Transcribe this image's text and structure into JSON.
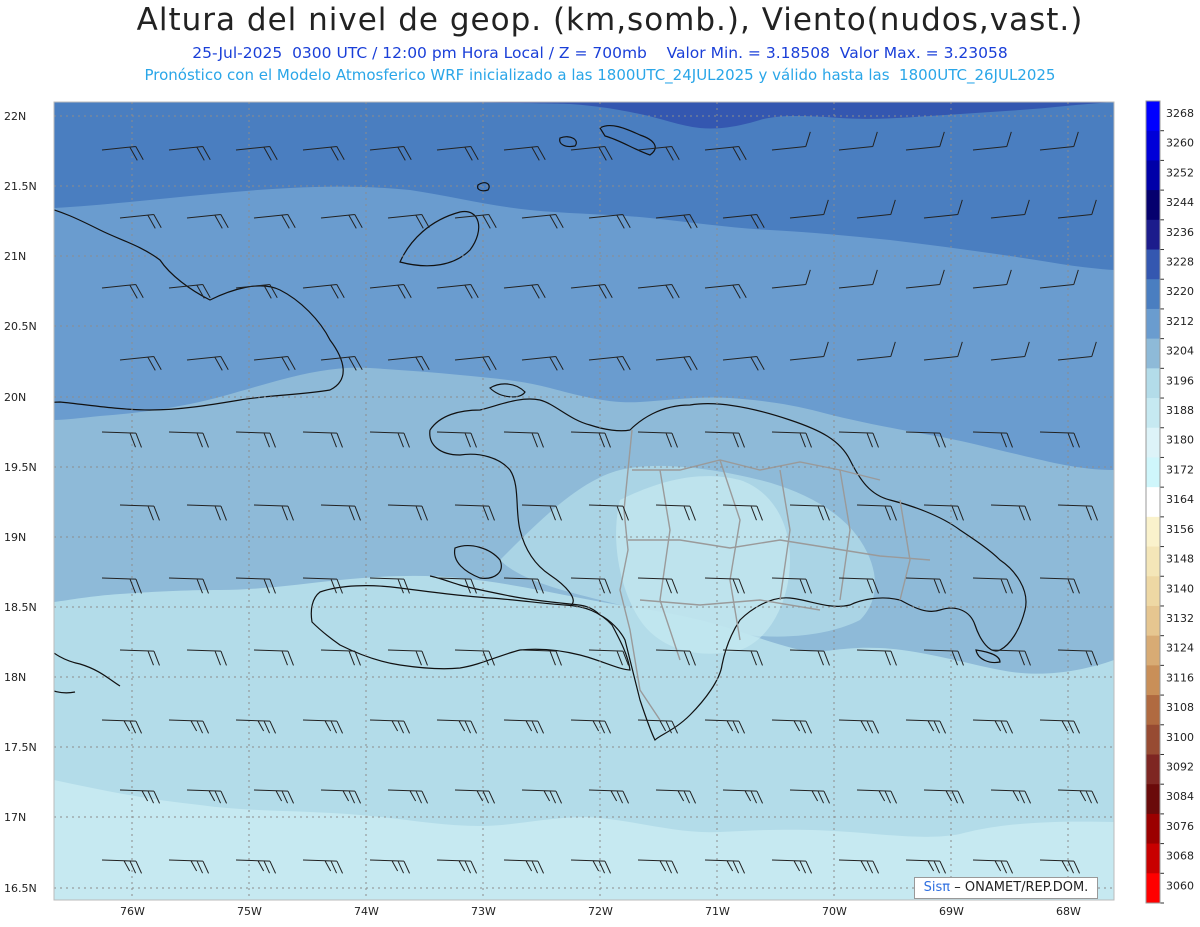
{
  "header": {
    "title": "Altura del nivel de geop. (km,somb.), Viento(nudos,vast.)",
    "subtitle": "25-Jul-2025  0300 UTC / 12:00 pm Hora Local / Z = 700mb    Valor Min. = 3.18508  Valor Max. = 3.23058",
    "subtitle2": "Pronóstico con el Modelo Atmosferico WRF inicializado a las 1800UTC_24JUL2025 y válido hasta las  1800UTC_26JUL2025"
  },
  "axes": {
    "lat_labels": [
      "22N",
      "21.5N",
      "21N",
      "20.5N",
      "20N",
      "19.5N",
      "19N",
      "18.5N",
      "18N",
      "17.5N",
      "17N",
      "16.5N"
    ],
    "lon_labels": [
      "76W",
      "75W",
      "74W",
      "73W",
      "72W",
      "71W",
      "70W",
      "69W",
      "68W"
    ]
  },
  "colorbar": {
    "labels": [
      "3268",
      "3260",
      "3252",
      "3244",
      "3236",
      "3228",
      "3220",
      "3212",
      "3204",
      "3196",
      "3188",
      "3180",
      "3172",
      "3164",
      "3156",
      "3148",
      "3140",
      "3132",
      "3124",
      "3116",
      "3108",
      "3100",
      "3092",
      "3084",
      "3076",
      "3068",
      "3060"
    ],
    "colors": [
      "#0000ff",
      "#0000d8",
      "#0000a8",
      "#05006e",
      "#1c1c8c",
      "#3457b0",
      "#4a7ec0",
      "#6a9ccf",
      "#8ebad8",
      "#b3dce9",
      "#c6e9f1",
      "#ddf3f8",
      "#cff6fb",
      "#ffffff",
      "#faf2cc",
      "#f4e6b8",
      "#eed8a4",
      "#e6c690",
      "#d8ab74",
      "#c98f58",
      "#b06a40",
      "#974b32",
      "#7e2622",
      "#6a0a0a",
      "#9b0000",
      "#c80000",
      "#ff0000"
    ]
  },
  "credit": {
    "brand": "Sisπ",
    "text": "– ONAMET/REP.DOM."
  }
}
